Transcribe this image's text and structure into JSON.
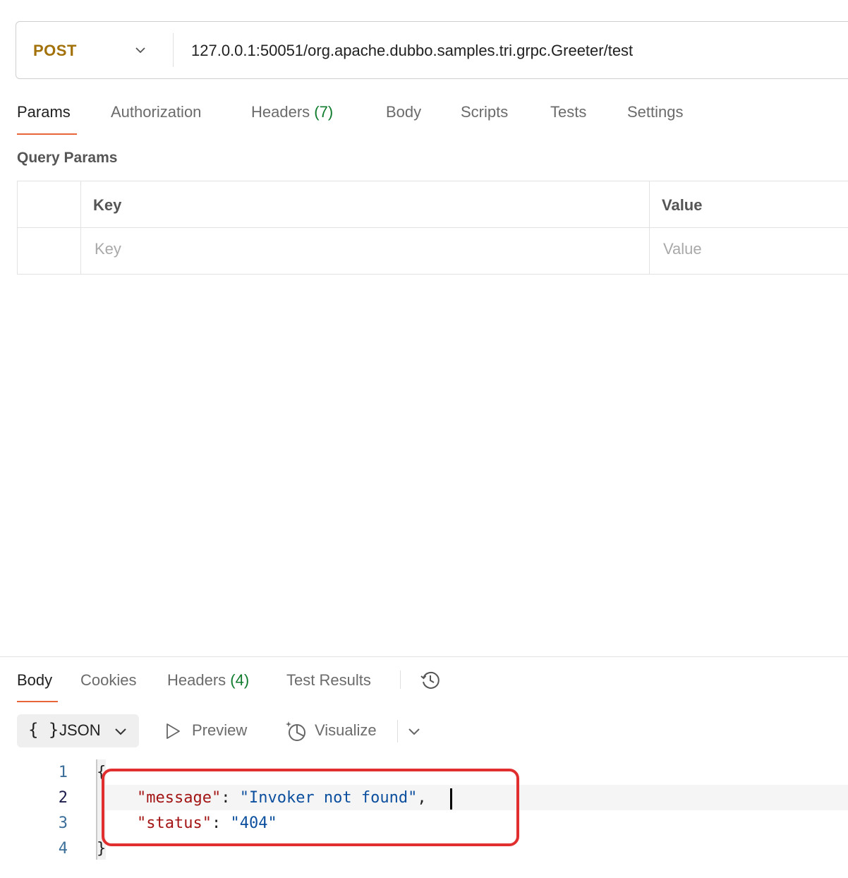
{
  "request": {
    "method": "POST",
    "url": "127.0.0.1:50051/org.apache.dubbo.samples.tri.grpc.Greeter/test"
  },
  "request_tabs": {
    "params": "Params",
    "authorization": "Authorization",
    "headers": "Headers",
    "headers_count": "(7)",
    "body": "Body",
    "scripts": "Scripts",
    "tests": "Tests",
    "settings": "Settings"
  },
  "query_params": {
    "title": "Query Params",
    "col_key": "Key",
    "col_value": "Value",
    "key_placeholder": "Key",
    "value_placeholder": "Value"
  },
  "response_tabs": {
    "body": "Body",
    "cookies": "Cookies",
    "headers": "Headers",
    "headers_count": "(4)",
    "test_results": "Test Results"
  },
  "response_toolbar": {
    "format_braces": "{ }",
    "format": "JSON",
    "preview": "Preview",
    "visualize": "Visualize"
  },
  "code": {
    "line_numbers": [
      "1",
      "2",
      "3",
      "4"
    ],
    "open_brace": "{",
    "close_brace": "}",
    "message_key": "\"message\"",
    "message_value": "\"Invoker not found\"",
    "status_key": "\"status\"",
    "status_value": "\"404\"",
    "colon": ": ",
    "comma": ","
  },
  "colors": {
    "accent": "#e8643a",
    "method": "#a2710a",
    "count": "#0f7b2d",
    "highlight_box": "#e12f2f"
  },
  "icons": {
    "method_dropdown": "chevron-down-icon",
    "history": "history-icon",
    "format_dropdown": "chevron-down-icon",
    "preview": "play-icon",
    "visualize": "visualize-icon",
    "more": "chevron-down-icon"
  }
}
